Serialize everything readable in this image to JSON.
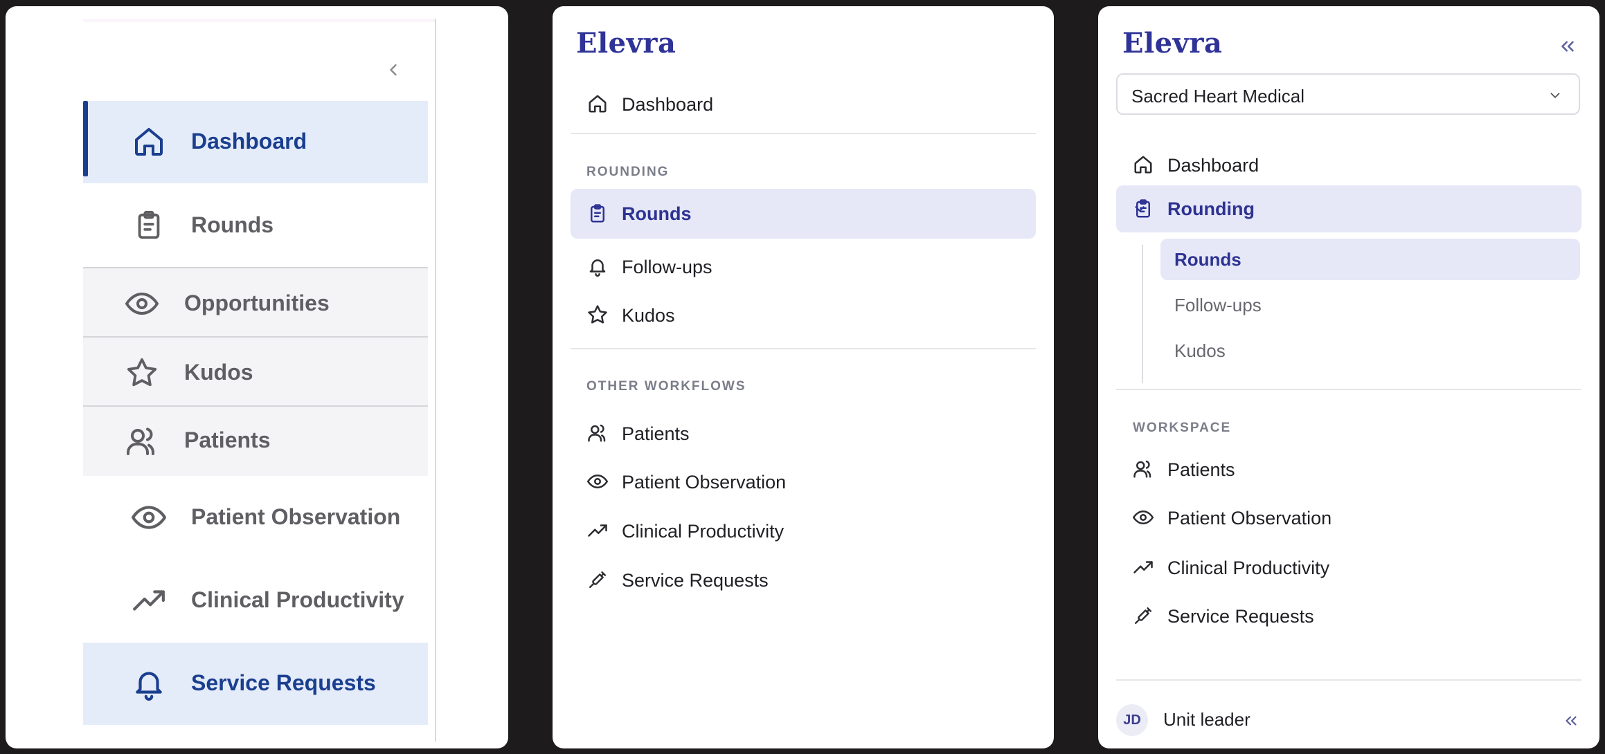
{
  "panel1": {
    "items": [
      {
        "label": "Dashboard",
        "icon": "home-icon"
      },
      {
        "label": "Rounds",
        "icon": "clipboard-icon"
      },
      {
        "label": "Opportunities",
        "icon": "eye-icon"
      },
      {
        "label": "Kudos",
        "icon": "star-icon"
      },
      {
        "label": "Patients",
        "icon": "users-icon"
      },
      {
        "label": "Patient Observation",
        "icon": "eye-icon"
      },
      {
        "label": "Clinical Productivity",
        "icon": "trending-up-icon"
      },
      {
        "label": "Service Requests",
        "icon": "bell-icon"
      }
    ],
    "colors": {
      "active_bg": "#e5ecf9",
      "active_text": "#1b3f8f"
    }
  },
  "panel2": {
    "logo": "Elevra",
    "dashboard": "Dashboard",
    "rounding_section": "ROUNDING",
    "rounding_items": [
      "Rounds",
      "Follow-ups",
      "Kudos"
    ],
    "other_section": "OTHER WORKFLOWS",
    "other_items": [
      "Patients",
      "Patient Observation",
      "Clinical Productivity",
      "Service Requests"
    ]
  },
  "panel3": {
    "logo": "Elevra",
    "org": "Sacred Heart Medical",
    "dashboard": "Dashboard",
    "rounding_group": "Rounding",
    "rounding_items": [
      "Rounds",
      "Follow-ups",
      "Kudos"
    ],
    "workspace_section": "WORKSPACE",
    "workspace_items": [
      "Patients",
      "Patient Observation",
      "Clinical Productivity",
      "Service Requests"
    ],
    "user_initials": "JD",
    "user_role": "Unit leader"
  },
  "colors": {
    "brand": "#2f3397",
    "active_bg": "#e6e8f8",
    "background": "#1d1b1c"
  }
}
